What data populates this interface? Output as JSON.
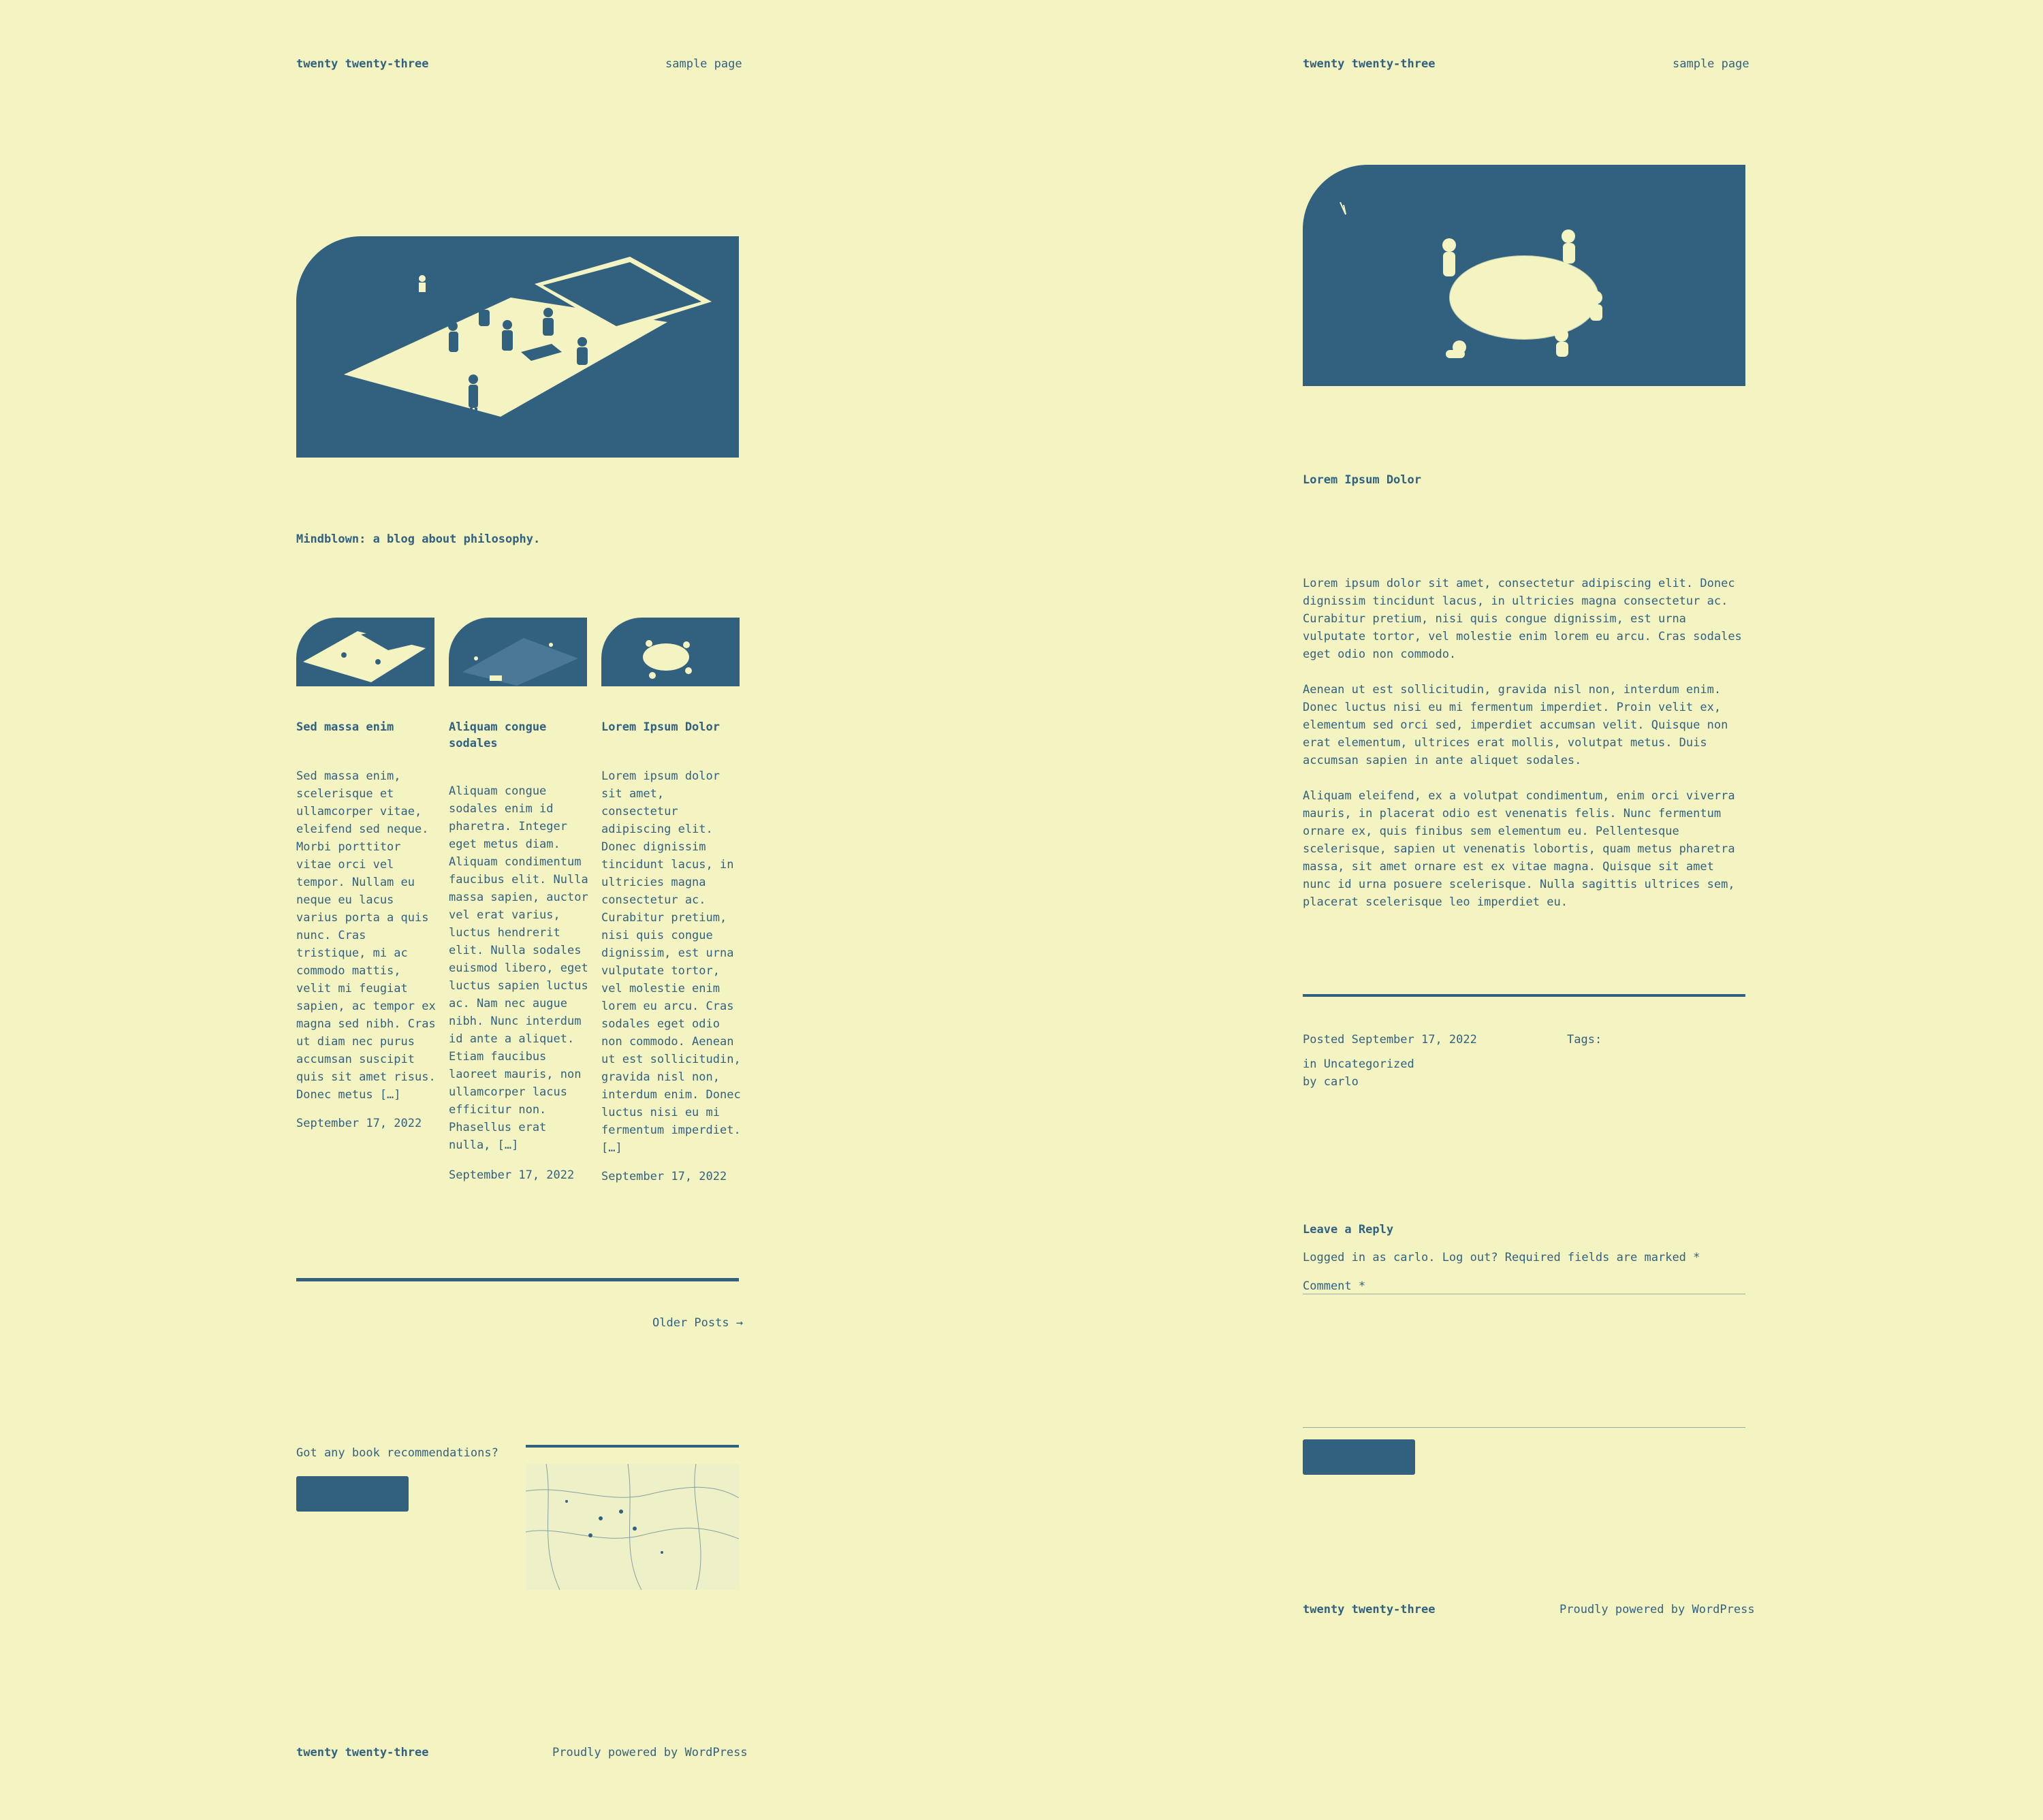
{
  "colors": {
    "background": "#f4f4c3",
    "primary": "#32617f"
  },
  "left": {
    "header": {
      "site_title": "twenty twenty-three",
      "nav_item": "sample page"
    },
    "tagline": "Mindblown: a blog about philosophy.",
    "posts": [
      {
        "title": "Sed massa enim",
        "excerpt": "Sed massa enim, scelerisque et ullamcorper vitae, eleifend sed neque. Morbi porttitor vitae orci vel tempor. Nullam eu neque eu lacus varius porta a quis nunc. Cras tristique, mi ac commodo mattis, velit mi feugiat sapien, ac tempor ex magna sed nibh. Cras ut diam nec purus accumsan suscipit quis sit amet risus. Donec metus […]",
        "date": "September 17, 2022"
      },
      {
        "title": "Aliquam congue sodales",
        "excerpt": "Aliquam congue sodales enim id pharetra. Integer eget metus diam. Aliquam condimentum faucibus elit. Nulla massa sapien, auctor vel erat varius, luctus hendrerit elit. Nulla sodales euismod libero, eget luctus sapien luctus ac. Nam nec augue nibh. Nunc interdum id ante a aliquet. Etiam faucibus laoreet mauris, non ullamcorper lacus efficitur non. Phasellus erat nulla, […]",
        "date": "September 17, 2022"
      },
      {
        "title": "Lorem Ipsum Dolor",
        "excerpt": "Lorem ipsum dolor sit amet, consectetur adipiscing elit. Donec dignissim tincidunt lacus, in ultricies magna consectetur ac. Curabitur pretium, nisi quis congue dignissim, est urna vulputate tortor, vel molestie enim lorem eu arcu. Cras sodales eget odio non commodo. Aenean ut est sollicitudin, gravida nisl non, interdum enim. Donec luctus nisi eu mi fermentum imperdiet. […]",
        "date": "September 17, 2022"
      }
    ],
    "older_posts": "Older Posts →",
    "cta_text": "Got any book recommendations?",
    "footer": {
      "site_title": "twenty twenty-three",
      "powered": "Proudly powered by WordPress"
    }
  },
  "right": {
    "header": {
      "site_title": "twenty twenty-three",
      "nav_item": "sample page"
    },
    "post_title": "Lorem Ipsum Dolor",
    "paragraphs": [
      "Lorem ipsum dolor sit amet, consectetur adipiscing elit. Donec dignissim tincidunt lacus, in ultricies magna consectetur ac. Curabitur pretium, nisi quis congue dignissim, est urna vulputate tortor, vel molestie enim lorem eu arcu. Cras sodales eget odio non commodo.",
      "Aenean ut est sollicitudin, gravida nisl non, interdum enim. Donec luctus nisi eu mi fermentum imperdiet. Proin velit ex, elementum sed orci sed, imperdiet accumsan velit. Quisque non erat elementum, ultrices erat mollis, volutpat metus. Duis accumsan sapien in ante aliquet sodales.",
      "Aliquam eleifend, ex a volutpat condimentum, enim orci viverra mauris, in placerat odio est venenatis felis. Nunc fermentum ornare ex, quis finibus sem elementum eu. Pellentesque scelerisque, sapien ut venenatis lobortis, quam metus pharetra massa, sit amet ornare est ex vitae magna. Quisque sit amet nunc id urna posuere scelerisque. Nulla sagittis ultrices sem, placerat scelerisque leo imperdiet eu."
    ],
    "meta": {
      "posted": "Posted September 17, 2022",
      "tags": "Tags:",
      "category": "in Uncategorized",
      "author": "by carlo"
    },
    "reply": {
      "title": "Leave a Reply",
      "logged_in": "Logged in as carlo. Log out? Required fields are marked *",
      "comment_label": "Comment *"
    },
    "footer": {
      "site_title": "twenty twenty-three",
      "powered": "Proudly powered by WordPress"
    }
  }
}
